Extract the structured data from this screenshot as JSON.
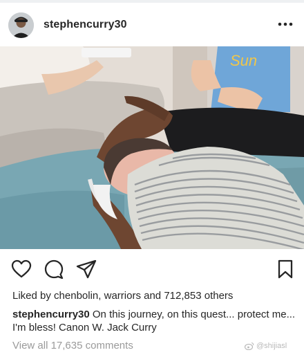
{
  "post": {
    "username": "stephencurry30",
    "more_icon": "more-horizontal-icon"
  },
  "photo": {
    "shirt_text": "Sun"
  },
  "actions": {
    "icons": [
      "heart-icon",
      "comment-icon",
      "share-icon",
      "bookmark-icon"
    ]
  },
  "likes": {
    "prefix": "Liked by ",
    "user1": "chenbolin",
    "sep": ", ",
    "user2": "warriors",
    "middle": " and ",
    "count": "712,853",
    "suffix": " others"
  },
  "caption": {
    "user": "stephencurry30",
    "text": "On this journey, on this quest... protect me... I'm bless!  Canon W. Jack Curry"
  },
  "comments": {
    "view_all": "View all 17,635 comments"
  },
  "watermark": {
    "text": "@shijiasl"
  },
  "colors": {
    "text": "#262626",
    "muted": "#9a9a9a",
    "background": "#ffffff"
  }
}
